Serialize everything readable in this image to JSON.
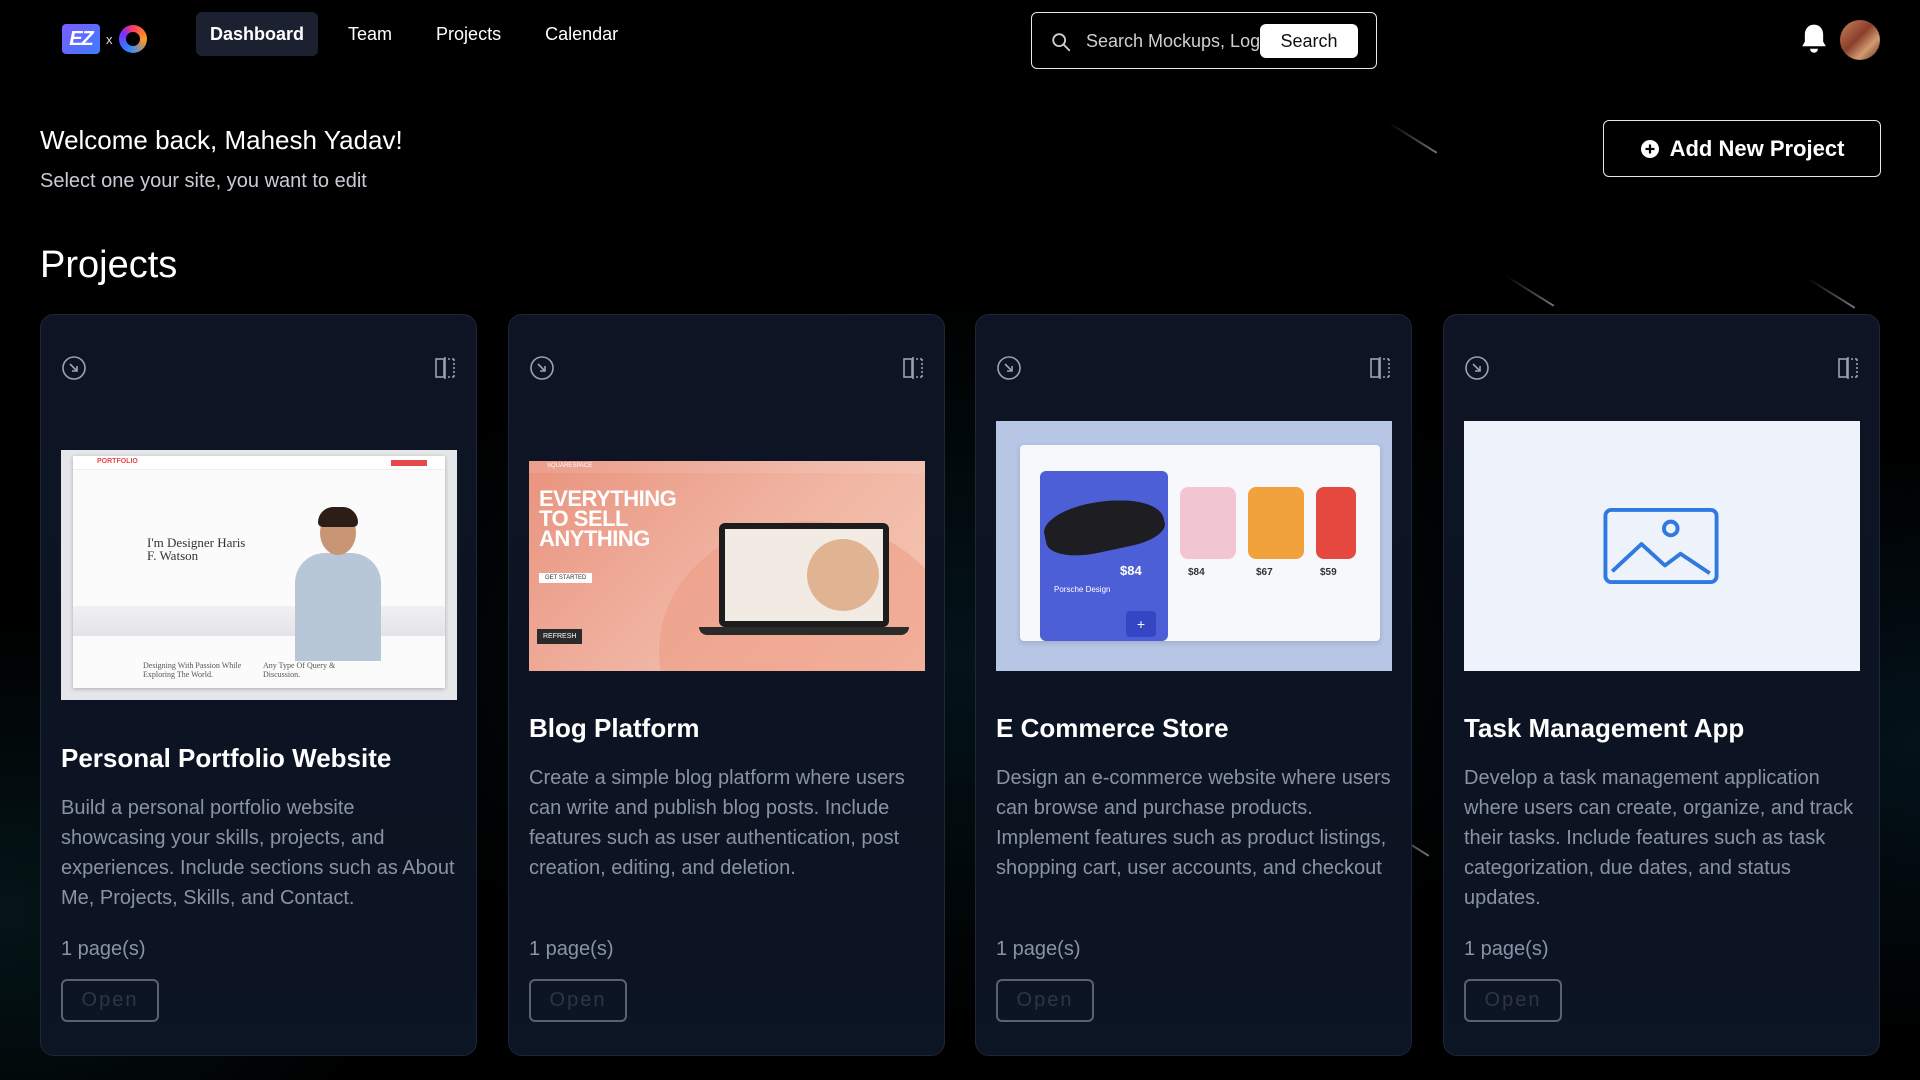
{
  "nav": {
    "logo_text": "EZ",
    "logo_separator": "x",
    "links": [
      {
        "label": "Dashboard",
        "active": true
      },
      {
        "label": "Team",
        "active": false
      },
      {
        "label": "Projects",
        "active": false
      },
      {
        "label": "Calendar",
        "active": false
      }
    ],
    "search": {
      "placeholder": "Search Mockups, Logos...",
      "button_label": "Search"
    }
  },
  "welcome": {
    "title": "Welcome back, Mahesh Yadav!",
    "subtitle": "Select one your site, you want to edit"
  },
  "add_button_label": "Add New Project",
  "projects_heading": "Projects",
  "projects": [
    {
      "title": "Personal Portfolio Website",
      "description": "Build a personal portfolio website showcasing your skills, projects, and experiences. Include sections such as About Me, Projects, Skills, and Contact.",
      "pages": "1 page(s)",
      "open_label": "Open",
      "thumb": {
        "headline": "I'm Designer Haris F. Watson",
        "brand": "PORTFOLIO",
        "footer_left": "Designing With Passion While Exploring The World.",
        "footer_right": "Any Type Of Query & Discussion."
      }
    },
    {
      "title": "Blog Platform",
      "description": "Create a simple blog platform where users can write and publish blog posts. Include features such as user authentication, post creation, editing, and deletion.",
      "pages": "1 page(s)",
      "open_label": "Open",
      "thumb": {
        "headline": "EVERYTHING TO SELL ANYTHING",
        "brand": "SQUARESPACE",
        "cta": "GET STARTED",
        "badge": "REFRESH"
      }
    },
    {
      "title": "E Commerce Store",
      "description": "Design an e-commerce website where users can browse and purchase products. Implement features such as product listings, shopping cart, user accounts, and checkout",
      "pages": "1 page(s)",
      "open_label": "Open",
      "thumb": {
        "feature_price": "$84",
        "feature_name": "Porsche Design",
        "prices": [
          "$84",
          "$67",
          "$59"
        ]
      }
    },
    {
      "title": "Task Management App",
      "description": "Develop a task management application where users can create, organize, and track their tasks. Include features such as task categorization, due dates, and status updates.",
      "pages": "1 page(s)",
      "open_label": "Open",
      "thumb": {
        "placeholder_icon": "image-placeholder-icon"
      }
    }
  ],
  "colors": {
    "background": "#000000",
    "card": "#0e1424",
    "muted_text": "#8a93a6",
    "active_nav": "#1b2131",
    "placeholder_blue": "#2f7ae0"
  }
}
